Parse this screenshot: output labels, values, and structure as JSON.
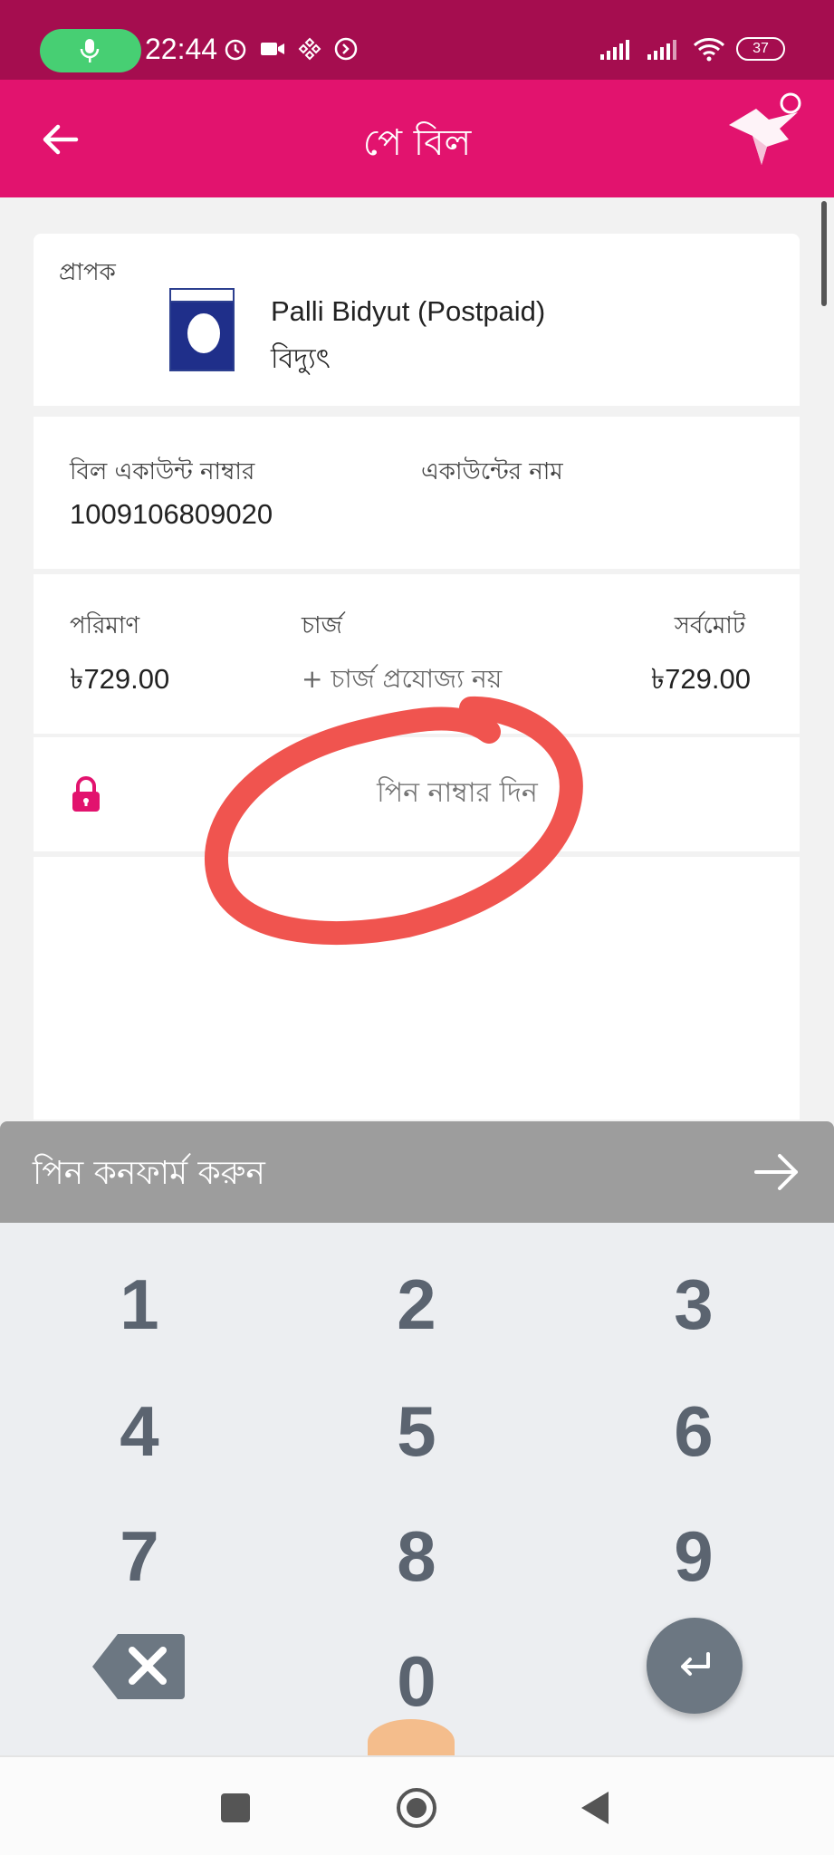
{
  "status_bar": {
    "time": "22:44",
    "battery": "37",
    "icons": [
      "microphone-icon",
      "alarm-icon",
      "video-recording-icon",
      "binance-icon",
      "shazam-icon",
      "signal-icon",
      "signal-icon",
      "wifi-icon",
      "battery-icon"
    ]
  },
  "app_bar": {
    "title": "পে বিল",
    "back_icon": "arrow-left-icon",
    "logo_icon": "bkash-bird-logo"
  },
  "recipient": {
    "label": "প্রাপক",
    "biller_name": "Palli Bidyut (Postpaid)",
    "biller_type": "বিদ্যুৎ"
  },
  "account": {
    "number_label": "বিল একাউন্ট নাম্বার",
    "number_value": "1009106809020",
    "name_label": "একাউন্টের নাম"
  },
  "amount": {
    "amount_label": "পরিমাণ",
    "amount_value": "৳729.00",
    "charge_label": "চার্জ",
    "charge_value": "+ চার্জ প্রযোজ্য নয়",
    "total_label": "সর্বমোট",
    "total_value": "৳729.00"
  },
  "pin": {
    "placeholder": "পিন নাম্বার দিন",
    "lock_icon": "lock-icon"
  },
  "confirm": {
    "label": "পিন কনফার্ম করুন",
    "arrow_icon": "arrow-right-icon"
  },
  "keypad": {
    "keys": [
      "1",
      "2",
      "3",
      "4",
      "5",
      "6",
      "7",
      "8",
      "9",
      "0"
    ],
    "backspace_icon": "backspace-icon",
    "enter_icon": "enter-icon"
  },
  "colors": {
    "status_bar": "#a50d4f",
    "brand": "#e2136e",
    "confirm_bar": "#9d9d9d",
    "keypad_bg": "#eceef1",
    "annotation": "#f0544f"
  }
}
